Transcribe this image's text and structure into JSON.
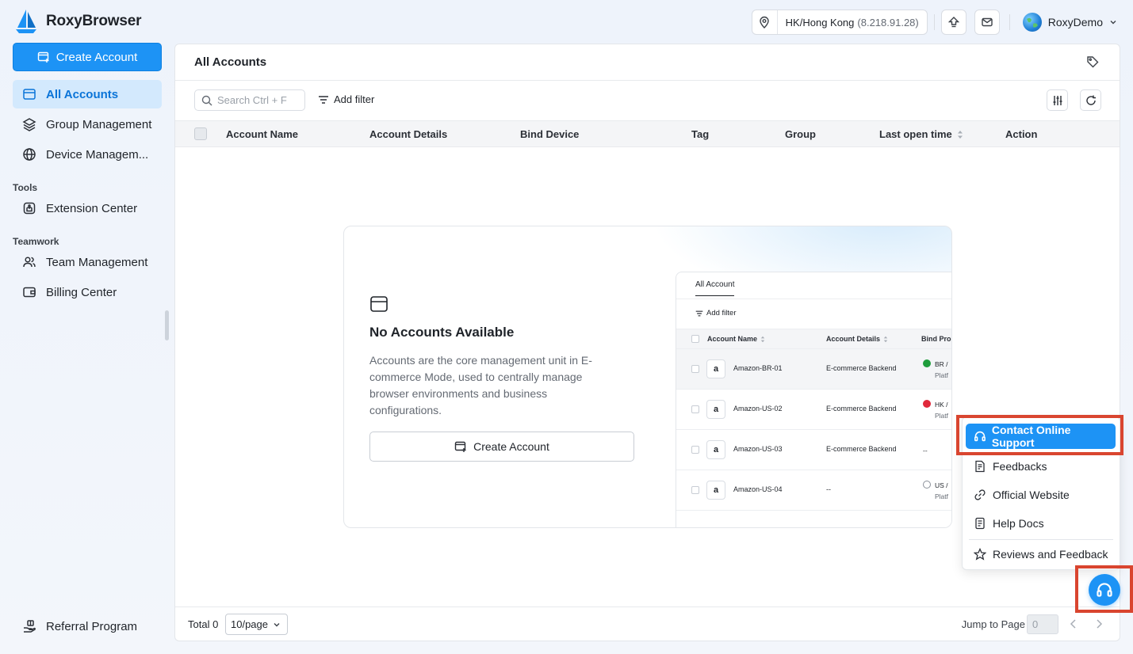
{
  "app": {
    "name": "RoxyBrowser"
  },
  "topbar": {
    "region": "HK/Hong Kong",
    "ip": "(8.218.91.28)",
    "user_name": "RoxyDemo"
  },
  "sidebar": {
    "create_label": "Create Account",
    "items": [
      {
        "label": "All Accounts",
        "icon": "browser-window-icon",
        "active": true
      },
      {
        "label": "Group Management",
        "icon": "layers-icon"
      },
      {
        "label": "Device Managem...",
        "icon": "globe-icon"
      }
    ],
    "tools_label": "Tools",
    "tools": [
      {
        "label": "Extension Center",
        "icon": "puzzle-icon"
      }
    ],
    "teamwork_label": "Teamwork",
    "teamwork": [
      {
        "label": "Team Management",
        "icon": "users-icon"
      },
      {
        "label": "Billing Center",
        "icon": "wallet-icon"
      }
    ],
    "referral_label": "Referral Program"
  },
  "main": {
    "title": "All Accounts",
    "search_placeholder": "Search Ctrl + F",
    "add_filter": "Add filter",
    "columns": [
      "Account Name",
      "Account Details",
      "Bind Device",
      "Tag",
      "Group",
      "Last open time",
      "Action"
    ]
  },
  "empty": {
    "title": "No Accounts Available",
    "description": "Accounts are the core management unit in E-commerce Mode, used to centrally manage browser environments and business configurations.",
    "button": "Create Account",
    "preview": {
      "tab": "All Account",
      "filter": "Add filter",
      "columns": [
        "Account Name",
        "Account Details",
        "Bind Pro"
      ],
      "rows": [
        {
          "name": "Amazon-BR-01",
          "details": "E-commerce Backend",
          "bind": "BR /",
          "bind_sub": "Platf",
          "flag_color": "#1f9d3c"
        },
        {
          "name": "Amazon-US-02",
          "details": "E-commerce Backend",
          "bind": "HK /",
          "bind_sub": "Platf",
          "flag_color": "#e0293b"
        },
        {
          "name": "Amazon-US-03",
          "details": "E-commerce Backend",
          "bind": "--",
          "bind_sub": "",
          "flag_color": ""
        },
        {
          "name": "Amazon-US-04",
          "details": "--",
          "bind": "US /",
          "bind_sub": "Platf",
          "flag_color": "#8a9099"
        }
      ]
    }
  },
  "footer": {
    "total": "Total 0",
    "page_size": "10/page",
    "jump_label": "Jump to Page",
    "jump_value": "0"
  },
  "support_menu": {
    "contact": "Contact Online Support",
    "items": [
      "Feedbacks",
      "Official Website",
      "Help Docs",
      "Reviews and Feedback"
    ]
  },
  "colors": {
    "accent": "#1d93f5",
    "active_bg": "#d3e9fd",
    "highlight": "#d9452f"
  }
}
